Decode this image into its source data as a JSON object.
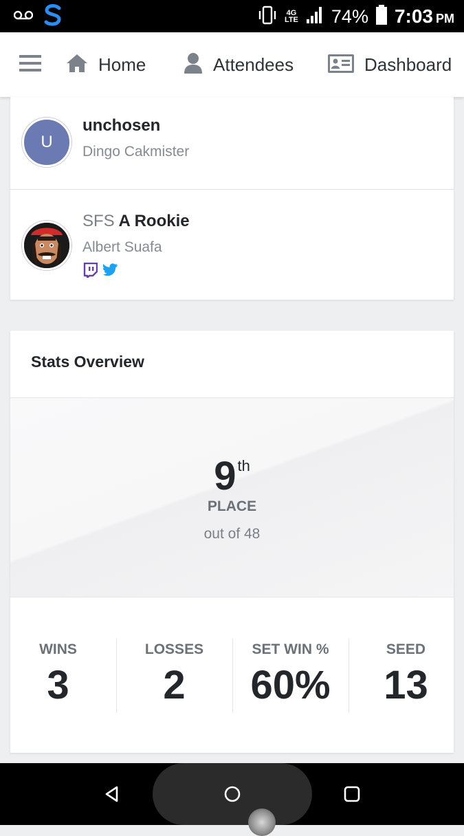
{
  "status_bar": {
    "battery": "74%",
    "time": "7:03",
    "ampm": "PM",
    "network": "4G",
    "network_sub": "LTE",
    "icons": [
      "voicemail-icon",
      "app-logo-icon",
      "vibrate-icon",
      "signal-icon",
      "battery-icon"
    ]
  },
  "nav": {
    "items": [
      {
        "label": "Home",
        "icon": "home-icon"
      },
      {
        "label": "Attendees",
        "icon": "user-icon"
      },
      {
        "label": "Dashboard",
        "icon": "id-card-icon"
      }
    ],
    "menu_icon": "hamburger-menu-icon"
  },
  "players": [
    {
      "initial": "U",
      "prefix": "",
      "gamertag": "unchosen",
      "real_name": "Dingo Cakmister"
    },
    {
      "initial": "",
      "prefix": "SFS",
      "gamertag": "A Rookie",
      "real_name": "Albert Suafa",
      "social": [
        "twitch-icon",
        "twitter-icon"
      ]
    }
  ],
  "stats": {
    "title": "Stats Overview",
    "place": "9",
    "place_suffix": "th",
    "place_label": "PLACE",
    "place_sub": "out of 48",
    "items": [
      {
        "label": "WINS",
        "value": "3"
      },
      {
        "label": "LOSSES",
        "value": "2"
      },
      {
        "label": "SET WIN %",
        "value": "60%"
      },
      {
        "label": "SEED",
        "value": "13"
      }
    ]
  },
  "colors": {
    "accent_avatar": "#6b7ab3",
    "twitch": "#6441a5",
    "twitter": "#1da1f2"
  }
}
